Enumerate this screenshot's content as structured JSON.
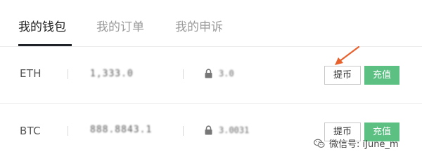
{
  "tabs": [
    {
      "label": "我的钱包",
      "active": true
    },
    {
      "label": "我的订单",
      "active": false
    },
    {
      "label": "我的申诉",
      "active": false
    }
  ],
  "wallets": [
    {
      "currency": "ETH",
      "balance": "1,333.0",
      "frozen": "3.0",
      "withdraw_label": "提币",
      "deposit_label": "充值"
    },
    {
      "currency": "BTC",
      "balance": "888.8843.1",
      "frozen": "3.0031",
      "withdraw_label": "提币",
      "deposit_label": "充值"
    }
  ],
  "watermark": {
    "text": "微信号: iJune_m",
    "icon": "wechat-icon"
  },
  "colors": {
    "accent_green": "#5cc083",
    "annotation_arrow": "#e8602c",
    "tab_underline": "#1f2227"
  }
}
